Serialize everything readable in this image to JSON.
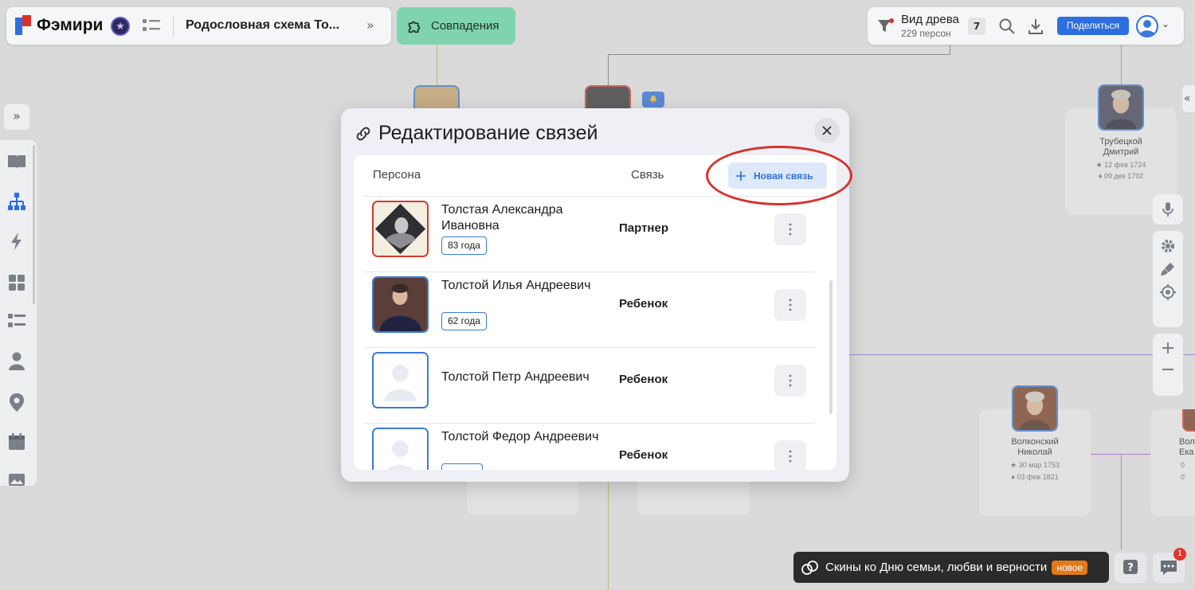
{
  "app": {
    "logo_text": "Фэмири",
    "tree_title": "Родословная схема То...",
    "matches_label": "Совпадения"
  },
  "toolbar": {
    "view_title": "Вид древа",
    "view_subtitle": "229 персон",
    "filter_count": "7",
    "share_label": "Поделиться"
  },
  "background_cards": [
    {
      "name": "Трубецкой Дмитрий",
      "birth": "12 фев 1724",
      "death": "09 дек 1792"
    },
    {
      "name": "Волконский Николай",
      "birth": "30 мар 1753",
      "death": "03 фев 1821"
    },
    {
      "name": "Вол Ека",
      "birth": "0",
      "death": "0"
    }
  ],
  "modal": {
    "title": "Редактирование связей",
    "col_person": "Персона",
    "col_relation": "Связь",
    "new_link_label": "Новая связь",
    "rows": [
      {
        "name": "Толстая Александра Ивановна",
        "age": "83 года",
        "relation": "Партнер",
        "gender": "female"
      },
      {
        "name": "Толстой Илья Андреевич",
        "age": "62 года",
        "relation": "Ребенок",
        "gender": "male"
      },
      {
        "name": "Толстой Петр Андреевич",
        "age": "",
        "relation": "Ребенок",
        "gender": "male"
      },
      {
        "name": "Толстой Федор Андреевич",
        "age": "",
        "relation": "Ребенок",
        "gender": "male"
      }
    ]
  },
  "promo": {
    "text": "Скины ко Дню семьи, любви и верности",
    "badge": "новое"
  },
  "chat": {
    "unread": "1"
  },
  "colors": {
    "accent": "#2d6fe0",
    "matches_bg": "#7fd4ae",
    "female_border": "#d43a2f",
    "male_border": "#3a7bd5",
    "highlight": "#d8322b"
  }
}
